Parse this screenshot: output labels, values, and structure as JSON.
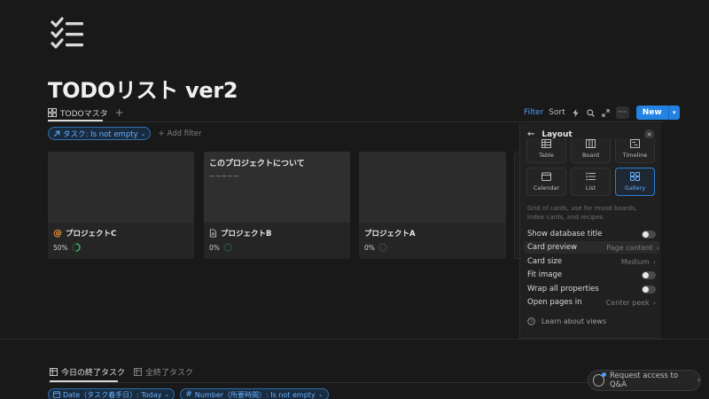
{
  "page": {
    "title": "TODOリスト ver2"
  },
  "views": {
    "tabs": [
      {
        "label": "TODOマスタ"
      }
    ]
  },
  "toolbar": {
    "filter_label": "Filter",
    "sort_label": "Sort",
    "new_label": "New"
  },
  "filters": {
    "pill": "タスク: Is not empty",
    "add_label": "Add filter"
  },
  "cards": [
    {
      "title": "プロジェクトC",
      "progress": "50%",
      "progress_value": 0.5,
      "preview_heading": "",
      "preview_text": ""
    },
    {
      "title": "プロジェクトB",
      "progress": "0%",
      "progress_value": 0,
      "preview_heading": "このプロジェクトについて",
      "preview_text": "~~~~~"
    },
    {
      "title": "プロジェクトA",
      "progress": "0%",
      "progress_value": 0,
      "preview_heading": "",
      "preview_text": ""
    }
  ],
  "layout_panel": {
    "title": "Layout",
    "layouts": [
      {
        "label": "Table"
      },
      {
        "label": "Board"
      },
      {
        "label": "Timeline"
      },
      {
        "label": "Calendar"
      },
      {
        "label": "List"
      },
      {
        "label": "Gallery",
        "selected": true
      }
    ],
    "description": "Grid of cards, use for mood boards, index cards, and recipes",
    "options": [
      {
        "label": "Show database title"
      },
      {
        "label": "Card preview",
        "value": "Page content"
      },
      {
        "label": "Card size",
        "value": "Medium"
      },
      {
        "label": "Fit image"
      },
      {
        "label": "Wrap all properties"
      },
      {
        "label": "Open pages in",
        "value": "Center peek"
      }
    ],
    "learn_label": "Learn about views"
  },
  "bottom": {
    "tabs": [
      {
        "label": "今日の終了タスク"
      },
      {
        "label": "全終了タスク"
      }
    ],
    "filters": [
      "Date（タスク着手日）: Today",
      "Number（所要時間）: Is not empty"
    ]
  },
  "qa": {
    "label": "Request access to Q&A"
  },
  "colors": {
    "accent": "#2383e2",
    "background": "#191919",
    "progress_green": "#3fb469"
  }
}
